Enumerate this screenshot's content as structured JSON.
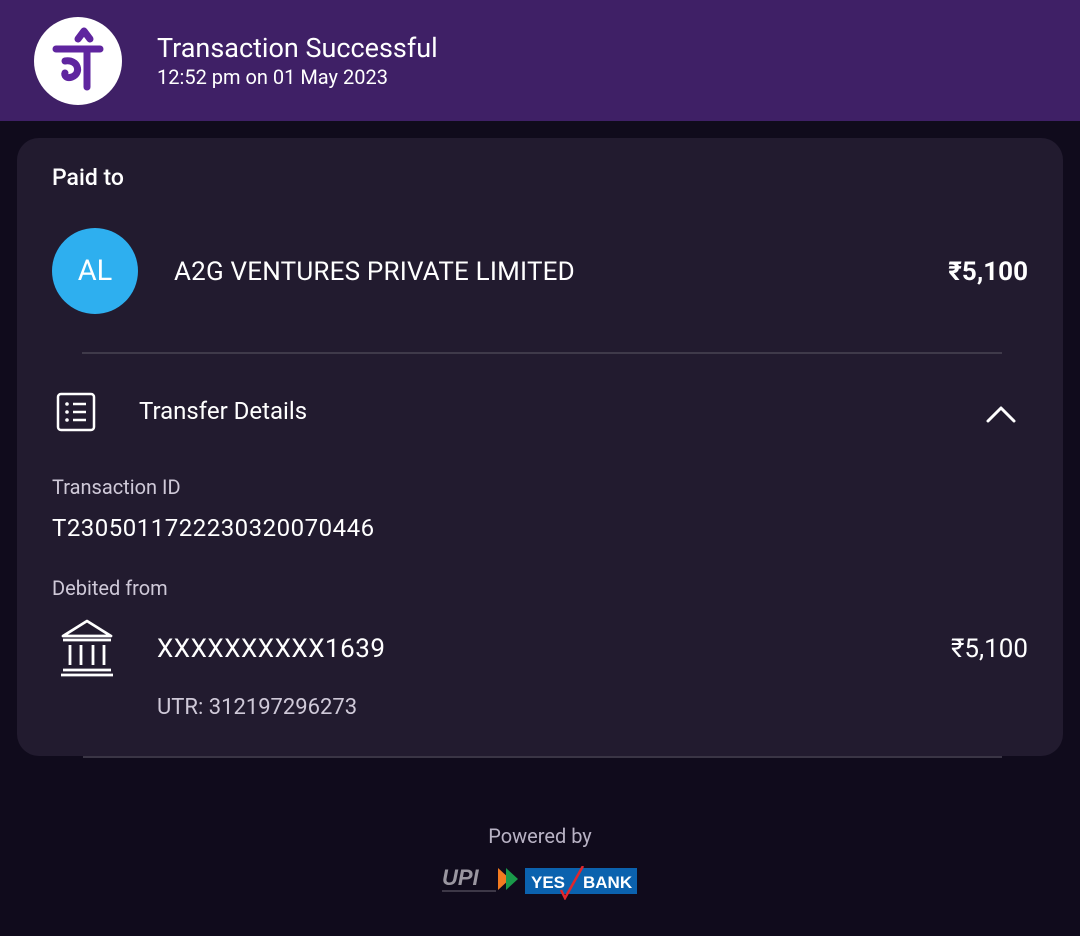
{
  "header": {
    "logo_icon": "phonepe-logo-icon",
    "title": "Transaction Successful",
    "timestamp": "12:52 pm on 01 May 2023"
  },
  "paid_to": {
    "label": "Paid to",
    "avatar_initials": "AL",
    "avatar_color": "#2eafef",
    "payee_name": "A2G VENTURES PRIVATE LIMITED",
    "amount": "₹5,100"
  },
  "transfer_details": {
    "icon": "receipt-list-icon",
    "label": "Transfer Details",
    "toggle_icon": "chevron-up-icon",
    "transaction_id_label": "Transaction ID",
    "transaction_id": "T2305011722230320070446",
    "debited_from_label": "Debited from",
    "bank_icon": "bank-icon",
    "account_number": "XXXXXXXXXX1639",
    "debited_amount": "₹5,100",
    "utr": "UTR: 312197296273"
  },
  "footer": {
    "powered_by": "Powered by",
    "upi_logo_text": "UPI",
    "bank_logo_text": "YES BANK",
    "bank_logo_yes": "YES",
    "bank_logo_bank": "BANK"
  },
  "colors": {
    "header_bg": "#3f2066",
    "page_bg": "#100b1c",
    "card_bg": "#221b2f",
    "brand_purple": "#5f259f"
  }
}
